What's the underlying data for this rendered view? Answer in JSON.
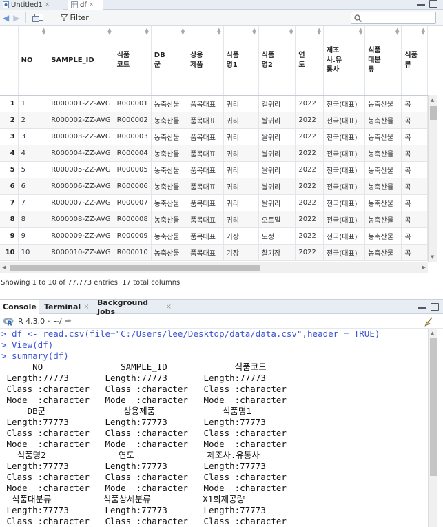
{
  "editor_tabs": [
    {
      "label": "Untitled1",
      "close": "×"
    },
    {
      "label": "df",
      "close": "×"
    }
  ],
  "toolbar": {
    "filter_label": "Filter",
    "search_placeholder": ""
  },
  "grid": {
    "columns": [
      "",
      "NO",
      "SAMPLE_ID",
      "식품\n코드",
      "DB\n군",
      "상용\n제품",
      "식품\n명1",
      "식품\n명2",
      "연\n도",
      "제조\n사.유\n통사",
      "식품\n대분\n류",
      "식품\n류"
    ],
    "rows": [
      [
        "1",
        "1",
        "R000001-ZZ-AVG",
        "R000001",
        "농축산물",
        "품목대표",
        "귀리",
        "겉귀리",
        "2022",
        "전국(대표)",
        "농축산물",
        "곡"
      ],
      [
        "2",
        "2",
        "R000002-ZZ-AVG",
        "R000002",
        "농축산물",
        "품목대표",
        "귀리",
        "쌀귀리",
        "2022",
        "전국(대표)",
        "농축산물",
        "곡"
      ],
      [
        "3",
        "3",
        "R000003-ZZ-AVG",
        "R000003",
        "농축산물",
        "품목대표",
        "귀리",
        "쌀귀리",
        "2022",
        "전국(대표)",
        "농축산물",
        "곡"
      ],
      [
        "4",
        "4",
        "R000004-ZZ-AVG",
        "R000004",
        "농축산물",
        "품목대표",
        "귀리",
        "쌀귀리",
        "2022",
        "전국(대표)",
        "농축산물",
        "곡"
      ],
      [
        "5",
        "5",
        "R000005-ZZ-AVG",
        "R000005",
        "농축산물",
        "품목대표",
        "귀리",
        "쌀귀리",
        "2022",
        "전국(대표)",
        "농축산물",
        "곡"
      ],
      [
        "6",
        "6",
        "R000006-ZZ-AVG",
        "R000006",
        "농축산물",
        "품목대표",
        "귀리",
        "쌀귀리",
        "2022",
        "전국(대표)",
        "농축산물",
        "곡"
      ],
      [
        "7",
        "7",
        "R000007-ZZ-AVG",
        "R000007",
        "농축산물",
        "품목대표",
        "귀리",
        "쌀귀리",
        "2022",
        "전국(대표)",
        "농축산물",
        "곡"
      ],
      [
        "8",
        "8",
        "R000008-ZZ-AVG",
        "R000008",
        "농축산물",
        "품목대표",
        "귀리",
        "오트밀",
        "2022",
        "전국(대표)",
        "농축산물",
        "곡"
      ],
      [
        "9",
        "9",
        "R000009-ZZ-AVG",
        "R000009",
        "농축산물",
        "품목대표",
        "기장",
        "도정",
        "2022",
        "전국(대표)",
        "농축산물",
        "곡"
      ],
      [
        "10",
        "10",
        "R000010-ZZ-AVG",
        "R000010",
        "농축산물",
        "품목대표",
        "기장",
        "찰기장",
        "2022",
        "전국(대표)",
        "농축산물",
        "곡"
      ]
    ]
  },
  "status_text": "Showing 1 to 10 of 77,773 entries, 17 total columns",
  "console_tabs": [
    {
      "label": "Console",
      "close": ""
    },
    {
      "label": "Terminal",
      "close": "×"
    },
    {
      "label": "Background Jobs",
      "close": "×"
    }
  ],
  "console_info": {
    "r_version": "R 4.3.0",
    "separator": "·",
    "wd": "~/"
  },
  "console_lines": [
    {
      "type": "cmd",
      "text": "> df <- read.csv(file=\"C:/Users/lee/Desktop/data/data.csv\",header = TRUE)"
    },
    {
      "type": "cmd",
      "text": "> View(df)"
    },
    {
      "type": "cmd",
      "text": "> summary(df)"
    },
    {
      "type": "out",
      "text": "      NO               SAMPLE_ID             식품코드"
    },
    {
      "type": "out",
      "text": " Length:77773       Length:77773       Length:77773"
    },
    {
      "type": "out",
      "text": " Class :character   Class :character   Class :character"
    },
    {
      "type": "out",
      "text": " Mode  :character   Mode  :character   Mode  :character"
    },
    {
      "type": "out",
      "text": "     DB군               상용제품             식품명1"
    },
    {
      "type": "out",
      "text": " Length:77773       Length:77773       Length:77773"
    },
    {
      "type": "out",
      "text": " Class :character   Class :character   Class :character"
    },
    {
      "type": "out",
      "text": " Mode  :character   Mode  :character   Mode  :character"
    },
    {
      "type": "out",
      "text": "   식품명2              연도              제조사.유통사"
    },
    {
      "type": "out",
      "text": " Length:77773       Length:77773       Length:77773"
    },
    {
      "type": "out",
      "text": " Class :character   Class :character   Class :character"
    },
    {
      "type": "out",
      "text": " Mode  :character   Mode  :character   Mode  :character"
    },
    {
      "type": "out",
      "text": "  식품대분류          식품상세분류          X1회제공량"
    },
    {
      "type": "out",
      "text": " Length:77773       Length:77773       Length:77773"
    },
    {
      "type": "out",
      "text": " Class :character   Class :character   Class :character"
    }
  ]
}
